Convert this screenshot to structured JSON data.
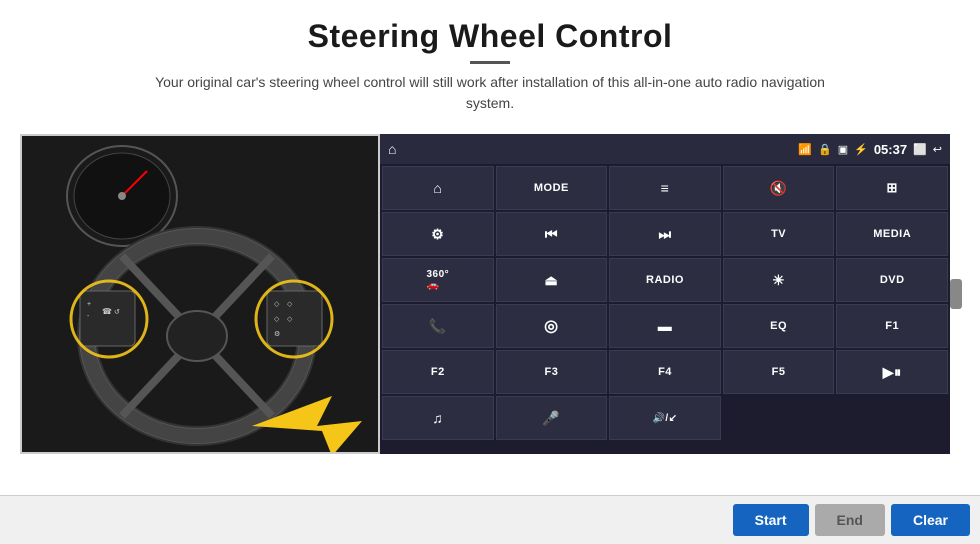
{
  "title": "Steering Wheel Control",
  "underline": true,
  "subtitle": "Your original car's steering wheel control will still work after installation of this all-in-one auto radio navigation system.",
  "status_bar": {
    "time": "05:37",
    "icons": [
      "wifi",
      "lock",
      "sd",
      "bluetooth",
      "cast",
      "back"
    ]
  },
  "button_rows": [
    [
      {
        "label": "▲",
        "type": "icon",
        "id": "home"
      },
      {
        "label": "MODE",
        "type": "text"
      },
      {
        "label": "≡",
        "type": "icon"
      },
      {
        "label": "🔇",
        "type": "icon"
      },
      {
        "label": "⊞",
        "type": "icon"
      }
    ],
    [
      {
        "label": "⚙",
        "type": "icon"
      },
      {
        "label": "⏮",
        "type": "icon"
      },
      {
        "label": "⏭",
        "type": "icon"
      },
      {
        "label": "TV",
        "type": "text"
      },
      {
        "label": "MEDIA",
        "type": "text"
      }
    ],
    [
      {
        "label": "360°",
        "type": "text"
      },
      {
        "label": "▲",
        "type": "icon"
      },
      {
        "label": "RADIO",
        "type": "text"
      },
      {
        "label": "☀",
        "type": "icon"
      },
      {
        "label": "DVD",
        "type": "text"
      }
    ],
    [
      {
        "label": "📞",
        "type": "icon"
      },
      {
        "label": "🌀",
        "type": "icon"
      },
      {
        "label": "▬",
        "type": "icon"
      },
      {
        "label": "EQ",
        "type": "text"
      },
      {
        "label": "F1",
        "type": "text"
      }
    ],
    [
      {
        "label": "F2",
        "type": "text"
      },
      {
        "label": "F3",
        "type": "text"
      },
      {
        "label": "F4",
        "type": "text"
      },
      {
        "label": "F5",
        "type": "text"
      },
      {
        "label": "▶⏸",
        "type": "icon"
      }
    ],
    [
      {
        "label": "♪",
        "type": "icon"
      },
      {
        "label": "🎤",
        "type": "icon"
      },
      {
        "label": "🔊/↙",
        "type": "icon"
      },
      {
        "label": "",
        "type": "empty"
      },
      {
        "label": "",
        "type": "empty"
      }
    ]
  ],
  "actions": {
    "start": "Start",
    "end": "End",
    "clear": "Clear"
  }
}
